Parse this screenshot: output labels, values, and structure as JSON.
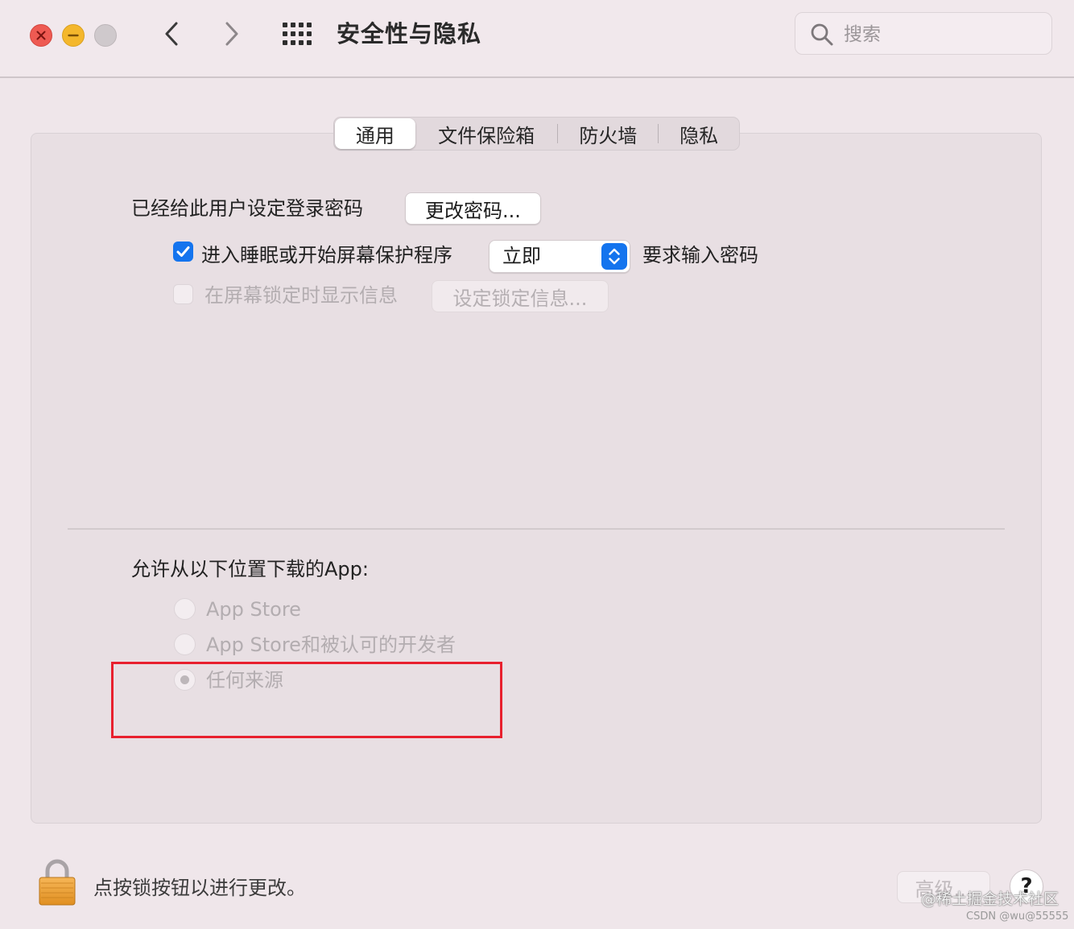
{
  "window": {
    "title": "安全性与隐私",
    "search_placeholder": "搜索"
  },
  "tabs": [
    {
      "label": "通用",
      "selected": true
    },
    {
      "label": "文件保险箱",
      "selected": false
    },
    {
      "label": "防火墙",
      "selected": false
    },
    {
      "label": "隐私",
      "selected": false
    }
  ],
  "general": {
    "password_label": "已经给此用户设定登录密码",
    "change_password_button": "更改密码...",
    "require_password": {
      "checked": true,
      "prefix_label": "进入睡眠或开始屏幕保护程序",
      "selected_option": "立即",
      "suffix_label": "要求输入密码"
    },
    "lock_message": {
      "checked": false,
      "label": "在屏幕锁定时显示信息",
      "button": "设定锁定信息..."
    }
  },
  "downloads": {
    "title": "允许从以下位置下载的App:",
    "options": [
      {
        "label": "App Store",
        "selected": false
      },
      {
        "label": "App Store和被认可的开发者",
        "selected": false
      },
      {
        "label": "任何来源",
        "selected": true
      }
    ]
  },
  "footer": {
    "lock_text": "点按锁按钮以进行更改。",
    "advanced_button": "高级...",
    "help_button": "?"
  },
  "watermark": {
    "line1": "@稀土掘金技术社区",
    "line2": "CSDN @wu@55555"
  },
  "colors": {
    "accent": "#1474ee",
    "highlight": "#e8202e",
    "close": "#ee5a52",
    "minimize": "#f4b72c"
  }
}
